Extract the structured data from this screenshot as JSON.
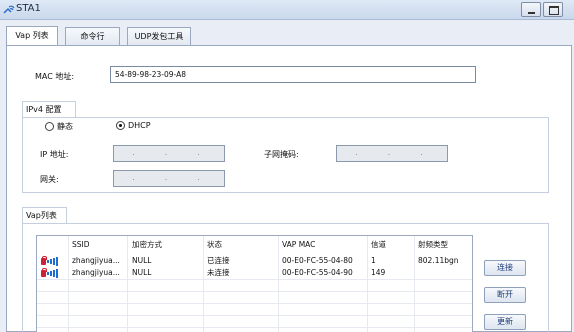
{
  "window": {
    "title": "STA1"
  },
  "tabs": [
    {
      "label": "Vap 列表"
    },
    {
      "label": "命令行"
    },
    {
      "label": "UDP发包工具"
    }
  ],
  "mac": {
    "label": "MAC 地址:",
    "value": "54-89-98-23-09-A8"
  },
  "ipv4": {
    "group_label": "IPv4 配置",
    "static_label": "静态",
    "dhcp_label": "DHCP",
    "selected": "DHCP",
    "ip_label": "IP 地址:",
    "mask_label": "子网掩码:",
    "gateway_label": "网关:",
    "ip_placeholder": ". . .",
    "mask_placeholder": ". . .",
    "gateway_placeholder": ". . ."
  },
  "vap": {
    "group_label": "Vap列表",
    "columns": [
      "SSID",
      "加密方式",
      "状态",
      "VAP MAC",
      "信道",
      "射频类型"
    ],
    "rows": [
      {
        "ssid": "zhangjiyua...",
        "encryption": "NULL",
        "status": "已连接",
        "vap_mac": "00-E0-FC-55-04-80",
        "channel": "1",
        "radio": "802.11bgn"
      },
      {
        "ssid": "zhangjiyua...",
        "encryption": "NULL",
        "status": "未连接",
        "vap_mac": "00-E0-FC-55-04-90",
        "channel": "149",
        "radio": ""
      }
    ]
  },
  "buttons": {
    "connect": "连接",
    "disconnect": "断开",
    "refresh": "更新"
  },
  "colors": {
    "accent": "#1f6fd1",
    "lock": "#cc2233"
  }
}
